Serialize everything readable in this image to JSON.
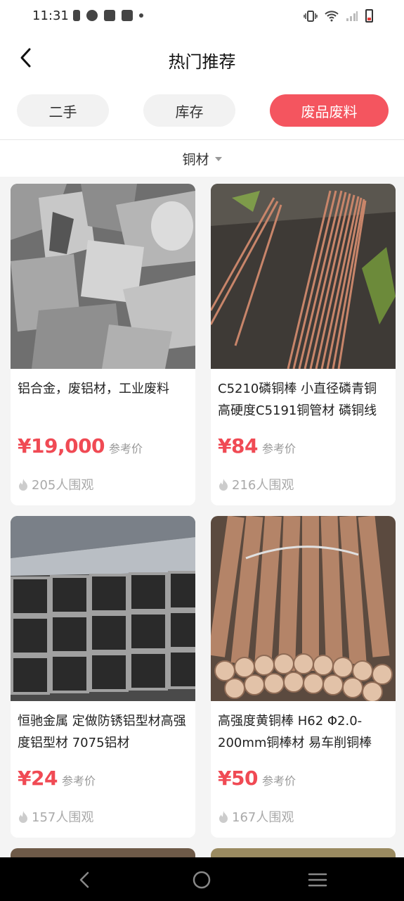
{
  "status_bar": {
    "time": "11:31"
  },
  "header": {
    "title": "热门推荐"
  },
  "tabs": [
    {
      "label": "二手"
    },
    {
      "label": "库存"
    },
    {
      "label": "废品废料",
      "active": true
    }
  ],
  "filter": {
    "label": "铜材"
  },
  "products": [
    {
      "title": " 铝合金，废铝材，工业废料",
      "price": "¥19,000",
      "price_note": "参考价",
      "views": "205人围观",
      "image": "scrap-aluminum-photo"
    },
    {
      "title": " C5210磷铜棒 小直径磷青铜 高硬度C5191铜管材 磷铜线",
      "price": "¥84",
      "price_note": "参考价",
      "views": "216人围观",
      "image": "copper-rods-photo"
    },
    {
      "title": " 恒驰金属 定做防锈铝型材高强度铝型材 7075铝材",
      "price": "¥24",
      "price_note": "参考价",
      "views": "157人围观",
      "image": "aluminum-profiles-photo"
    },
    {
      "title": " 高强度黄铜棒 H62 Φ2.0-200mm铜棒材 易车削铜棒",
      "price": "¥50",
      "price_note": "参考价",
      "views": "167人围观",
      "image": "brass-bars-photo"
    }
  ],
  "colors": {
    "accent": "#f4555f",
    "price": "#f04a54"
  }
}
